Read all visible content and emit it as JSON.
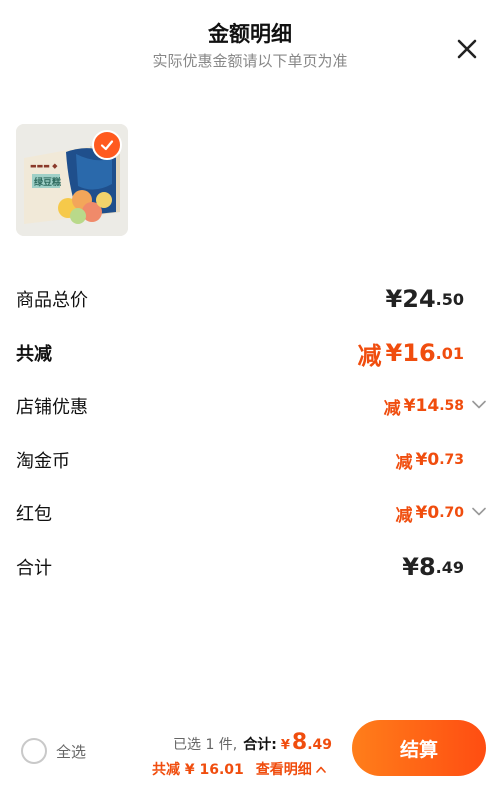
{
  "header": {
    "title": "金额明细",
    "subtitle": "实际优惠金额请以下单页为准"
  },
  "product": {
    "selected": true,
    "package_text": "绿豆糕"
  },
  "breakdown": {
    "total_price": {
      "label": "商品总价",
      "currency": "¥",
      "integer": "24",
      "decimal": ".50"
    },
    "total_reduction": {
      "label": "共减",
      "prefix": "减",
      "currency": "¥",
      "integer": "16",
      "decimal": ".01"
    },
    "shop_discount": {
      "label": "店铺优惠",
      "prefix": "减",
      "currency": "¥",
      "integer": "14",
      "decimal": ".58"
    },
    "taojinbi": {
      "label": "淘金币",
      "prefix": "减",
      "currency": "¥",
      "integer": "0",
      "decimal": ".73"
    },
    "red_packet": {
      "label": "红包",
      "prefix": "减",
      "currency": "¥",
      "integer": "0",
      "decimal": ".70"
    },
    "subtotal": {
      "label": "合计",
      "currency": "¥",
      "integer": "8",
      "decimal": ".49"
    }
  },
  "footer": {
    "select_all_label": "全选",
    "selected_count_text": "已选 1 件,",
    "sum_label": "合计:",
    "sum_currency": "¥",
    "sum_integer": "8",
    "sum_decimal": ".49",
    "savings_text": "共减 ¥ 16.01",
    "detail_link": "查看明细",
    "checkout_label": "结算"
  },
  "colors": {
    "accent": "#f04d0e",
    "checkout_gradient_start": "#ff7e1a",
    "checkout_gradient_end": "#ff4d12"
  },
  "icons": {
    "close": "close-icon",
    "check": "check-icon",
    "chevron": "chevron-down-icon",
    "caret_up": "chevron-up-icon"
  }
}
